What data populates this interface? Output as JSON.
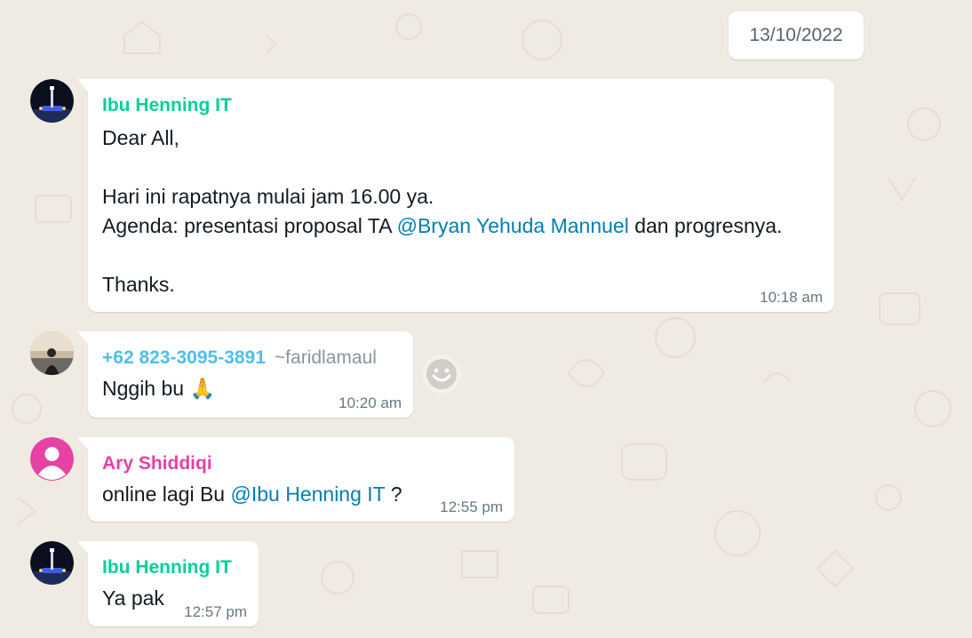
{
  "chat": {
    "date_separator": "13/10/2022",
    "messages": [
      {
        "sender": "Ibu Henning IT",
        "sender_color": "#06cf9c",
        "lines": [
          "Dear All,",
          "",
          "Hari ini rapatnya mulai jam 16.00 ya.",
          "Agenda: presentasi proposal TA ",
          "@Bryan Yehuda Mannuel",
          " dan progresnya.",
          "",
          "Thanks."
        ],
        "time": "10:18 am",
        "avatar_icon": "profile-photo-icon"
      },
      {
        "sender": "+62 823-3095-3891",
        "sender_subname": "~faridlamaul",
        "sender_color": "#53bdeb",
        "text": "Nggih bu ",
        "emoji": "🙏",
        "time": "10:20 am",
        "avatar_icon": "profile-photo-icon"
      },
      {
        "sender": "Ary Shiddiqi",
        "sender_color": "#e542a3",
        "text_before": "online lagi Bu ",
        "mention": "@Ibu Henning IT",
        "text_after": " ?",
        "time": "12:55 pm",
        "avatar_icon": "default-user-icon",
        "avatar_color": "#e542a3"
      },
      {
        "sender": "Ibu Henning IT",
        "sender_color": "#06cf9c",
        "text": "Ya pak",
        "time": "12:57 pm",
        "avatar_icon": "profile-photo-icon"
      }
    ],
    "reaction_button_icon": "emoji-smile-icon",
    "mention_color": "#027eb5",
    "background_color": "#efeae2"
  }
}
